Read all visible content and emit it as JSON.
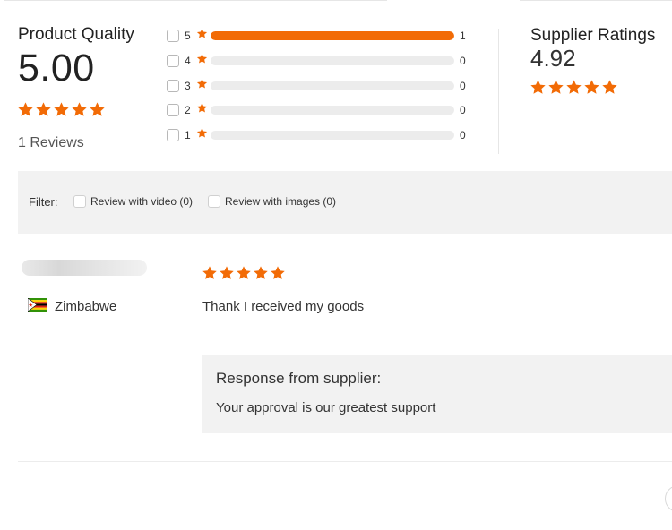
{
  "product_quality": {
    "title": "Product Quality",
    "score": "5.00",
    "stars": 5,
    "reviews_label": "1 Reviews"
  },
  "distribution": [
    {
      "stars": "5",
      "count": "1",
      "fraction": 1.0
    },
    {
      "stars": "4",
      "count": "0",
      "fraction": 0
    },
    {
      "stars": "3",
      "count": "0",
      "fraction": 0
    },
    {
      "stars": "2",
      "count": "0",
      "fraction": 0
    },
    {
      "stars": "1",
      "count": "0",
      "fraction": 0
    }
  ],
  "supplier": {
    "title": "Supplier Ratings",
    "score": "4.92",
    "stars": 5
  },
  "filter": {
    "label": "Filter:",
    "options": [
      "Review with video (0)",
      "Review with images (0)"
    ]
  },
  "review": {
    "country": "Zimbabwe",
    "stars": 5,
    "text": "Thank I received my goods",
    "response_title": "Response from supplier:",
    "response_text": "Your approval is our greatest support"
  },
  "colors": {
    "accent": "#f26b06",
    "bar_bg": "#ececec",
    "panel_bg": "#f2f2f2"
  },
  "icons": [
    "star-icon",
    "checkbox-icon",
    "zimbabwe-flag-icon"
  ]
}
